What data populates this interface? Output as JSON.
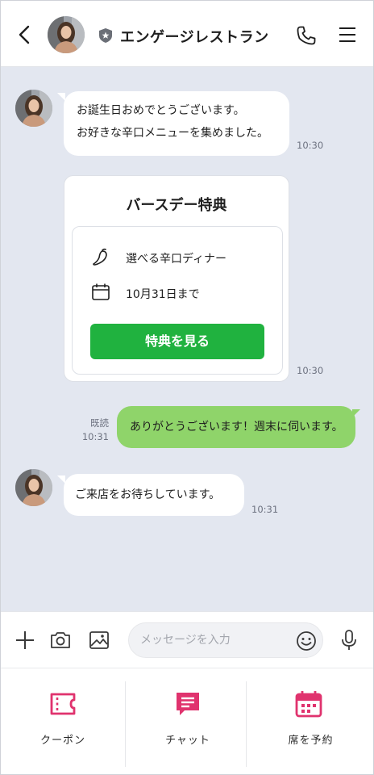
{
  "header": {
    "title": "エンゲージレストラン",
    "icons": [
      "back-arrow-icon",
      "avatar",
      "shield-star-icon",
      "phone-icon",
      "hamburger-menu-icon"
    ]
  },
  "messages": {
    "m1": {
      "line1": "お誕生日おめでとうございます。",
      "line2": "お好きな辛口メニューを集めました。",
      "time": "10:30"
    },
    "card": {
      "title": "バースデー特典",
      "row1": "選べる辛口ディナー",
      "row2": "10月31日まで",
      "button": "特典を見る",
      "time": "10:30"
    },
    "sent": {
      "text": "ありがとうございます！週末に伺います。",
      "read": "既読",
      "time": "10:31"
    },
    "m3": {
      "text": "ご来店をお待ちしています。",
      "time": "10:31"
    }
  },
  "input": {
    "placeholder": "メッセージを入力",
    "icons": [
      "plus-icon",
      "camera-icon",
      "image-icon",
      "emoji-icon",
      "microphone-icon"
    ]
  },
  "richmenu": {
    "coupon": "クーポン",
    "chat": "チャット",
    "reserve": "席を予約"
  },
  "colors": {
    "chat_bg": "#e3e7f0",
    "sent_bubble": "#8fd46a",
    "cta_green": "#20b23f",
    "accent_pink": "#e0336e"
  }
}
